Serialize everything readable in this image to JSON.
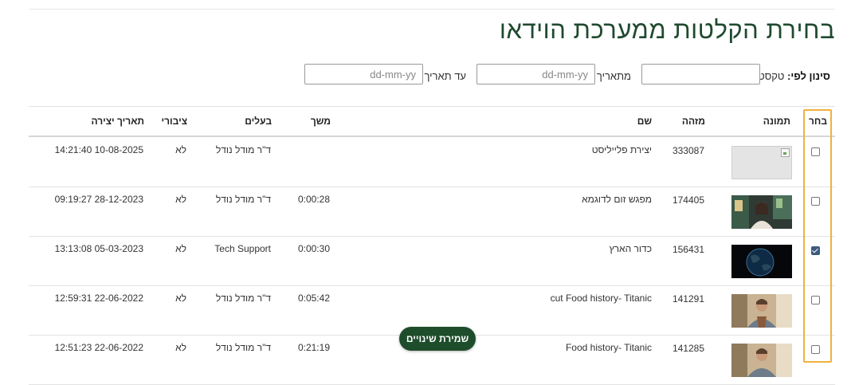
{
  "page_title": "בחירת הקלטות ממערכת הוידאו",
  "filter": {
    "label_bold": "סינון לפי:",
    "label_text": "טקסט",
    "text_value": "",
    "from_label": "מתאריך",
    "from_placeholder": "dd-mm-yy",
    "to_label": "עד תאריך",
    "to_placeholder": "dd-mm-yy"
  },
  "table": {
    "headers": {
      "select": "בחר",
      "thumbnail": "תמונה",
      "id": "מזהה",
      "name": "שם",
      "duration": "משך",
      "owner": "בעלים",
      "public": "ציבורי",
      "created": "תאריך יצירה"
    },
    "rows": [
      {
        "checked": false,
        "thumb": "broken-image",
        "id": "333087",
        "name": "יצירת פלייליסט",
        "duration": "",
        "owner": "ד\"ר מודל נודל",
        "public": "לא",
        "created": "14:21:40 10-08-2025"
      },
      {
        "checked": false,
        "thumb": "woman-in-room",
        "id": "174405",
        "name": "מפגש זום לדוגמא",
        "duration": "0:00:28",
        "owner": "ד\"ר מודל נודל",
        "public": "לא",
        "created": "09:19:27 28-12-2023"
      },
      {
        "checked": true,
        "thumb": "earth-globe",
        "id": "156431",
        "name": "כדור הארץ",
        "duration": "0:00:30",
        "owner": "Tech Support",
        "public": "לא",
        "created": "13:13:08 05-03-2023"
      },
      {
        "checked": false,
        "thumb": "man-presenter",
        "id": "141291",
        "name": "cut Food history- Titanic",
        "duration": "0:05:42",
        "owner": "ד\"ר מודל נודל",
        "public": "לא",
        "created": "12:59:31 22-06-2022"
      },
      {
        "checked": false,
        "thumb": "man-presenter",
        "id": "141285",
        "name": "Food history- Titanic",
        "duration": "0:21:19",
        "owner": "ד\"ר מודל נודל",
        "public": "לא",
        "created": "12:51:23 22-06-2022"
      }
    ]
  },
  "save_button": "שמירת שינויים",
  "colors": {
    "title": "#1f4a2f",
    "save_button_bg": "#1e4d2c",
    "select_highlight": "#f0b13e"
  }
}
